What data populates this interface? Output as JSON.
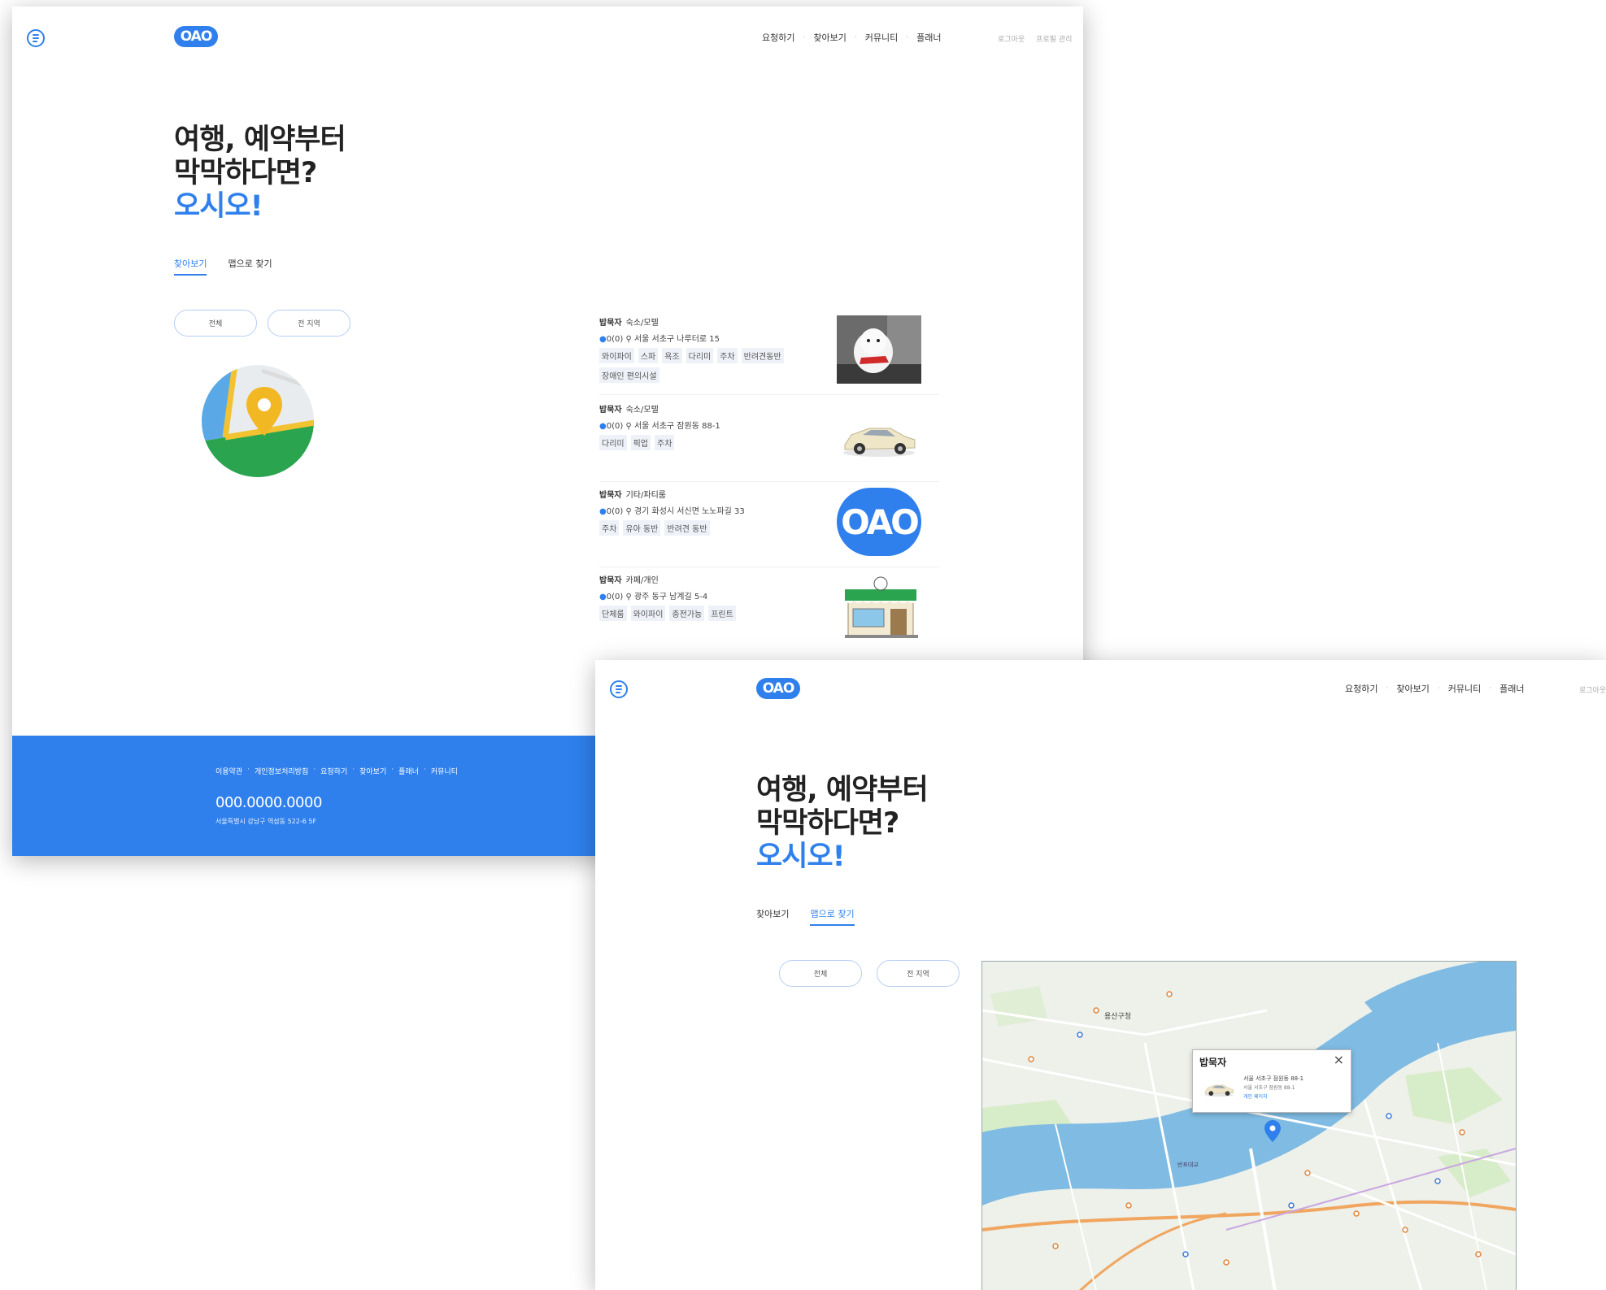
{
  "header": {
    "logo": "OAO",
    "nav": [
      "요청하기",
      "찾아보기",
      "커뮤니티",
      "플래너"
    ],
    "aux": [
      "로그아웃",
      "프로필 관리"
    ]
  },
  "hero": {
    "line1": "여행, 예약부터",
    "line2": "막막하다면?",
    "line3": "오시오!"
  },
  "screen1": {
    "tabs": [
      {
        "label": "찾아보기",
        "active": true
      },
      {
        "label": "맵으로 찾기",
        "active": false
      }
    ],
    "filters": [
      "전체",
      "전 지역"
    ]
  },
  "listings": [
    {
      "name": "밥묵자",
      "category": "숙소/모텔",
      "address": "0(0) ⚲ 서울 서초구 나루터로 15",
      "tags": [
        "와이파이",
        "스파",
        "욕조",
        "다리미",
        "주차",
        "반려견동반",
        "장애인 편의시설"
      ],
      "thumb": "dog-photo"
    },
    {
      "name": "밥묵자",
      "category": "숙소/모텔",
      "address": "0(0) ⚲ 서울 서초구 잠원동 88-1",
      "tags": [
        "다리미",
        "픽업",
        "주차"
      ],
      "thumb": "car-image"
    },
    {
      "name": "밥묵자",
      "category": "기타/파티룸",
      "address": "0(0) ⚲ 경기 화성시 서신면 노노파길 33",
      "tags": [
        "주차",
        "유아 동반",
        "반려견 동반"
      ],
      "thumb": "oao-logo"
    },
    {
      "name": "밥묵자",
      "category": "카페/개인",
      "address": "0(0) ⚲ 광주 동구 남계길 5-4",
      "tags": [
        "단체룸",
        "와이파이",
        "충전가능",
        "프린트"
      ],
      "thumb": "cafe-storefront"
    }
  ],
  "footer": {
    "links": [
      "이용약관",
      "개인정보처리방침",
      "요청하기",
      "찾아보기",
      "플래너",
      "커뮤니티"
    ],
    "phone": "000.0000.0000",
    "address": "서울특별시 강남구 역삼동 522-6 5F"
  },
  "screen2": {
    "tabs": [
      {
        "label": "찾아보기",
        "active": false
      },
      {
        "label": "맵으로 찾기",
        "active": true
      }
    ],
    "filters": [
      "전체",
      "전 지역"
    ],
    "popup": {
      "title": "밥묵자",
      "close": "×",
      "address": "서울 서초구 잠원동 88-1",
      "address_detail": "서울 서초구 잠원동 88-1",
      "link": "개인 페이지"
    },
    "map_labels": [
      "용산구청",
      "반포대교"
    ]
  },
  "colors": {
    "accent": "#2f80ed",
    "footer_bg": "#2f80ed",
    "tag_bg": "#eef2f8",
    "river": "#7fbbe3"
  }
}
